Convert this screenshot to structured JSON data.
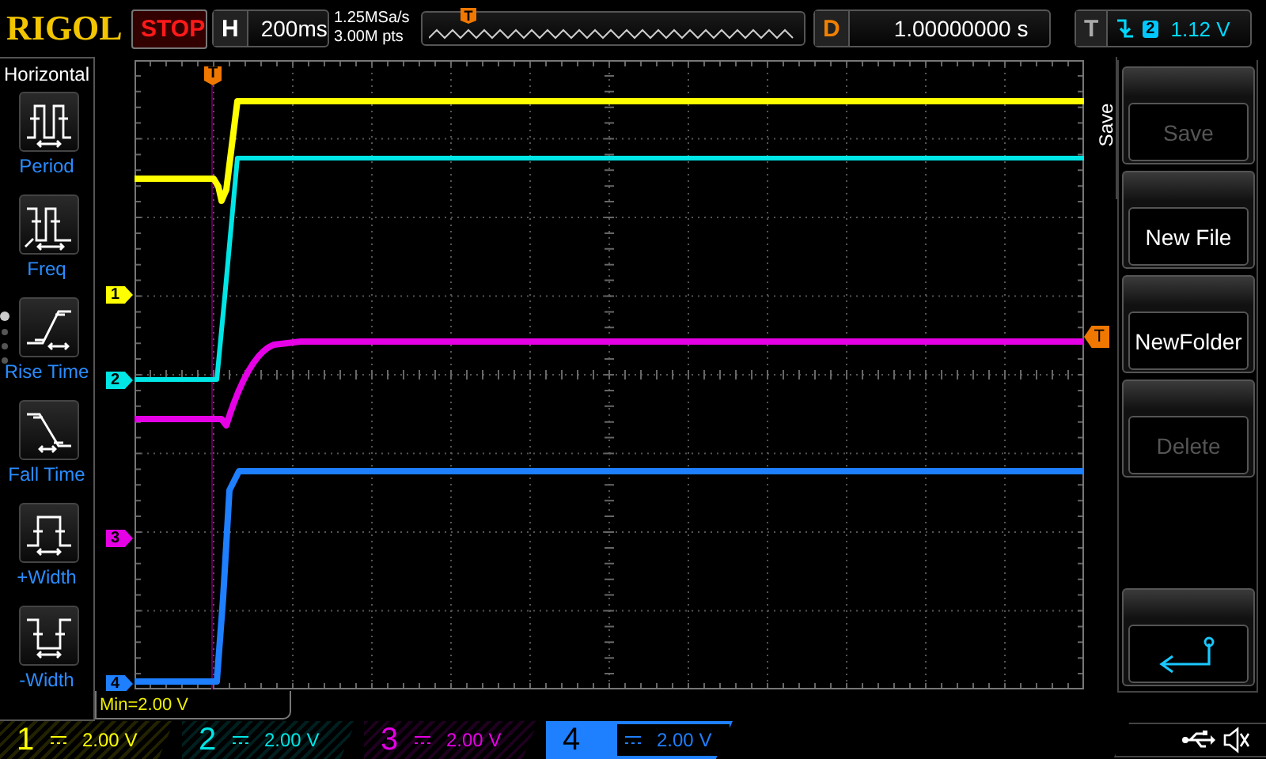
{
  "header": {
    "logo": "RIGOL",
    "run_state": "STOP",
    "timebase_label": "H",
    "timebase": "200ms",
    "sample_rate": "1.25MSa/s",
    "memory_depth": "3.00M pts",
    "position_marker": "T",
    "delay_label": "D",
    "delay": "1.00000000 s",
    "trigger_label": "T",
    "trigger_source": "2",
    "trigger_level": "1.12 V"
  },
  "sidebar": {
    "title": "Horizontal",
    "pages": [
      {
        "selected": true
      },
      {
        "selected": false
      },
      {
        "selected": false
      },
      {
        "selected": false
      }
    ],
    "items": [
      {
        "label": "Period",
        "kind": "period"
      },
      {
        "label": "Freq",
        "kind": "freq"
      },
      {
        "label": "Rise Time",
        "kind": "rise"
      },
      {
        "label": "Fall Time",
        "kind": "fall"
      },
      {
        "label": "+Width",
        "kind": "pwidth"
      },
      {
        "label": "-Width",
        "kind": "nwidth"
      }
    ]
  },
  "display": {
    "trigger_marker": "T",
    "trigger_level_marker": "T",
    "measurement": "Min=2.00 V"
  },
  "menu": {
    "title": "Save",
    "buttons": [
      {
        "label": "Save",
        "disabled": true,
        "kind": "text"
      },
      {
        "label": "New File",
        "disabled": false,
        "kind": "text"
      },
      {
        "label": "NewFolder",
        "disabled": false,
        "kind": "text"
      },
      {
        "label": "Delete",
        "disabled": true,
        "kind": "text"
      },
      {
        "kind": "back"
      }
    ]
  },
  "channels": [
    {
      "marker": "1",
      "number": "1",
      "scale": "2.00 V",
      "color": "#ffff00",
      "selected": false
    },
    {
      "marker": "2",
      "number": "2",
      "scale": "2.00 V",
      "color": "#00e5e5",
      "selected": false
    },
    {
      "marker": "3",
      "number": "3",
      "scale": "2.00 V",
      "color": "#e600e6",
      "selected": false
    },
    {
      "marker": "4",
      "number": "4",
      "scale": "2.00 V",
      "color": "#1e7fff",
      "selected": true
    }
  ]
}
